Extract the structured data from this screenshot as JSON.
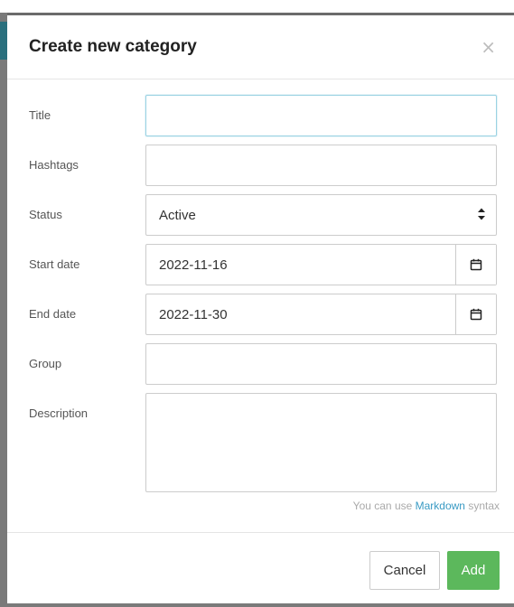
{
  "dialog": {
    "title": "Create new category",
    "close_label": "×"
  },
  "form": {
    "title": {
      "label": "Title",
      "value": ""
    },
    "hashtags": {
      "label": "Hashtags",
      "value": ""
    },
    "status": {
      "label": "Status",
      "value": "Active"
    },
    "start_date": {
      "label": "Start date",
      "value": "2022-11-16"
    },
    "end_date": {
      "label": "End date",
      "value": "2022-11-30"
    },
    "group": {
      "label": "Group",
      "value": ""
    },
    "description": {
      "label": "Description",
      "value": ""
    }
  },
  "hint": {
    "prefix": "You can use ",
    "link": "Markdown",
    "suffix": " syntax"
  },
  "footer": {
    "cancel_label": "Cancel",
    "add_label": "Add"
  },
  "colors": {
    "add_button": "#5cb85c",
    "link": "#3a9bc4",
    "focus_border": "#9bd2e3"
  },
  "icons": {
    "close": "close-icon",
    "select": "select-arrows-icon",
    "calendar": "calendar-icon"
  }
}
